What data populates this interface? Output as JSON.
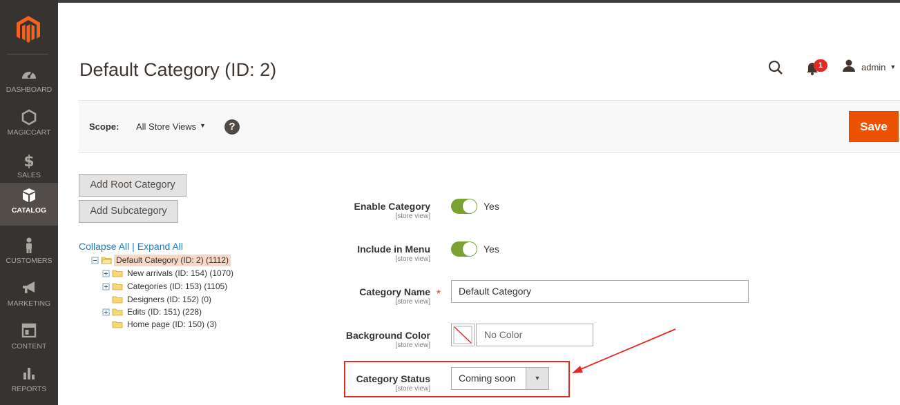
{
  "sidebar": {
    "logo_icon": "magento-logo-icon",
    "items": [
      {
        "label": "DASHBOARD",
        "icon": "gauge-icon",
        "active": false
      },
      {
        "label": "MAGICCART",
        "icon": "hexagon-icon",
        "active": false
      },
      {
        "label": "SALES",
        "icon": "dollar-icon",
        "active": false
      },
      {
        "label": "CATALOG",
        "icon": "box-icon",
        "active": true
      },
      {
        "label": "CUSTOMERS",
        "icon": "person-icon",
        "active": false
      },
      {
        "label": "MARKETING",
        "icon": "megaphone-icon",
        "active": false
      },
      {
        "label": "CONTENT",
        "icon": "layout-icon",
        "active": false
      },
      {
        "label": "REPORTS",
        "icon": "bar-chart-icon",
        "active": false
      }
    ]
  },
  "header": {
    "title": "Default Category (ID: 2)",
    "notification_count": "1",
    "user_name": "admin"
  },
  "scope": {
    "label": "Scope:",
    "value": "All Store Views",
    "help": "?"
  },
  "actions": {
    "save_label": "Save",
    "add_root_label": "Add Root Category",
    "add_sub_label": "Add Subcategory",
    "collapse_all": "Collapse All",
    "separator": "|",
    "expand_all": "Expand All"
  },
  "tree": [
    {
      "label": "Default Category (ID: 2) (1112)",
      "toggle": "minus",
      "selected": true
    },
    {
      "label": "New arrivals (ID: 154) (1070)",
      "toggle": "plus",
      "selected": false
    },
    {
      "label": "Categories (ID: 153) (1105)",
      "toggle": "plus",
      "selected": false
    },
    {
      "label": "Designers (ID: 152) (0)",
      "toggle": "none",
      "selected": false
    },
    {
      "label": "Edits (ID: 151) (228)",
      "toggle": "plus",
      "selected": false
    },
    {
      "label": "Home page (ID: 150) (3)",
      "toggle": "none",
      "selected": false
    }
  ],
  "form": {
    "enable_category": {
      "label": "Enable Category",
      "scope": "[store view]",
      "value": "Yes"
    },
    "include_in_menu": {
      "label": "Include in Menu",
      "scope": "[store view]",
      "value": "Yes"
    },
    "category_name": {
      "label": "Category Name",
      "scope": "[store view]",
      "required": "*",
      "value": "Default Category"
    },
    "background_color": {
      "label": "Background Color",
      "scope": "[store view]",
      "value": "No Color"
    },
    "category_status": {
      "label": "Category Status",
      "scope": "[store view]",
      "value": "Coming soon"
    }
  },
  "colors": {
    "accent": "#eb5202",
    "sidebar": "#373330",
    "toggle_on": "#79a22e",
    "highlight": "#e02b27",
    "link": "#1979c3"
  }
}
